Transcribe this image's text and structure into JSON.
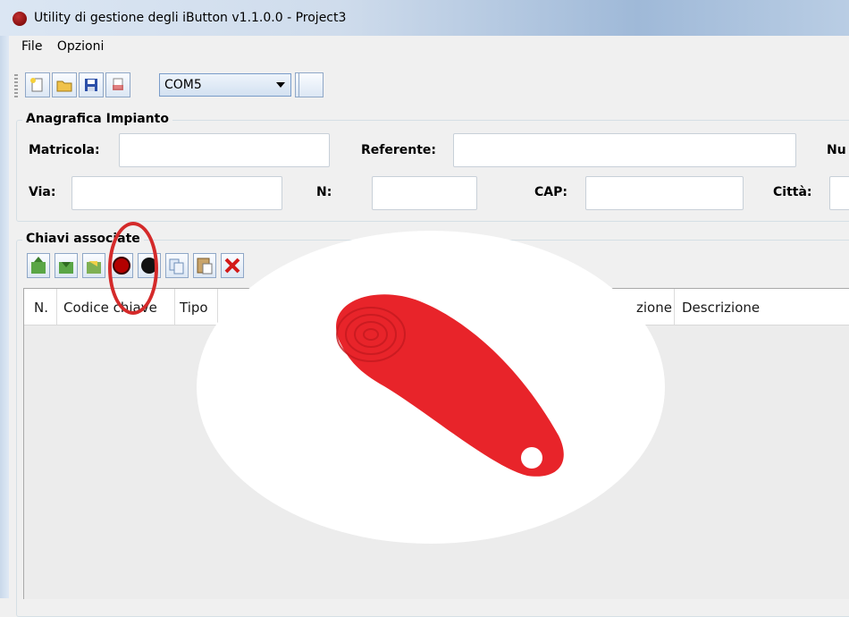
{
  "window": {
    "title": "Utility di gestione degli iButton v1.1.0.0 - Project3"
  },
  "menu": {
    "items": [
      "File",
      "Opzioni"
    ]
  },
  "toolbar": {
    "buttons": [
      "new-file-icon",
      "open-folder-icon",
      "save-disk-icon",
      "print-icon",
      "connect-icon",
      "search-icon"
    ],
    "com_port": "COM5"
  },
  "anagrafica": {
    "title": "Anagrafica Impianto",
    "matricola_label": "Matricola:",
    "referente_label": "Referente:",
    "nu_label": "Nu",
    "via_label": "Via:",
    "n_label": "N:",
    "cap_label": "CAP:",
    "citta_label": "Città:"
  },
  "chiavi": {
    "title": "Chiavi associate",
    "buttons": [
      "import-icon",
      "export-icon",
      "write-icon",
      "read-key-icon",
      "black-key-icon",
      "copy-icon",
      "paste-icon",
      "delete-icon"
    ],
    "columns": [
      "N.",
      "Codice chiave",
      "Tipo",
      "zione",
      "Descrizione"
    ]
  },
  "colors": {
    "highlight": "#d42a2a",
    "ibutton": "#e8242a"
  }
}
